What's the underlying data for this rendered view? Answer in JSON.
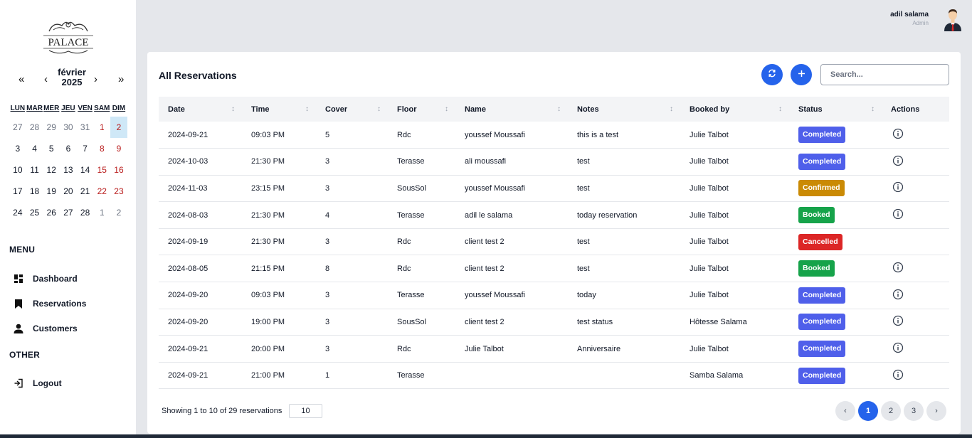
{
  "brand": {
    "logo_text": "PALACE"
  },
  "calendar": {
    "nav": {
      "prev_year": "«",
      "prev_month": "‹",
      "next_month": "›",
      "next_year": "»"
    },
    "month": "février",
    "year": "2025",
    "weekdays": [
      "LUN",
      "MAR",
      "MER",
      "JEU",
      "VEN",
      "SAM",
      "DIM"
    ],
    "weeks": [
      [
        "27",
        "28",
        "29",
        "30",
        "31",
        "1",
        "2"
      ],
      [
        "3",
        "4",
        "5",
        "6",
        "7",
        "8",
        "9"
      ],
      [
        "10",
        "11",
        "12",
        "13",
        "14",
        "15",
        "16"
      ],
      [
        "17",
        "18",
        "19",
        "20",
        "21",
        "22",
        "23"
      ],
      [
        "24",
        "25",
        "26",
        "27",
        "28",
        "1",
        "2"
      ]
    ]
  },
  "sidebar": {
    "menu_title": "MENU",
    "items": [
      {
        "label": "Dashboard",
        "icon": "dashboard-icon"
      },
      {
        "label": "Reservations",
        "icon": "bookmark-icon"
      },
      {
        "label": "Customers",
        "icon": "user-icon"
      }
    ],
    "other_title": "OTHER",
    "other_items": [
      {
        "label": "Logout",
        "icon": "logout-icon"
      }
    ]
  },
  "header": {
    "user_name": "adil salama",
    "user_role": "Admin"
  },
  "reservations": {
    "title": "All Reservations",
    "search_placeholder": "Search...",
    "columns": [
      "Date",
      "Time",
      "Cover",
      "Floor",
      "Name",
      "Notes",
      "Booked by",
      "Status",
      "Actions"
    ],
    "rows": [
      {
        "date": "2024-09-21",
        "time": "09:03 PM",
        "cover": "5",
        "floor": "Rdc",
        "name": "youssef Moussafi",
        "notes": "this is a test",
        "booked_by": "Julie Talbot",
        "status": "Completed"
      },
      {
        "date": "2024-10-03",
        "time": "21:30 PM",
        "cover": "3",
        "floor": "Terasse",
        "name": "ali moussafi",
        "notes": "test",
        "booked_by": "Julie Talbot",
        "status": "Completed"
      },
      {
        "date": "2024-11-03",
        "time": "23:15 PM",
        "cover": "3",
        "floor": "SousSol",
        "name": "youssef Moussafi",
        "notes": "test",
        "booked_by": "Julie Talbot",
        "status": "Confirmed"
      },
      {
        "date": "2024-08-03",
        "time": "21:30 PM",
        "cover": "4",
        "floor": "Terasse",
        "name": "adil le salama",
        "notes": "today reservation",
        "booked_by": "Julie Talbot",
        "status": "Booked"
      },
      {
        "date": "2024-09-19",
        "time": "21:30 PM",
        "cover": "3",
        "floor": "Rdc",
        "name": "client test 2",
        "notes": "test",
        "booked_by": "Julie Talbot",
        "status": "Cancelled"
      },
      {
        "date": "2024-08-05",
        "time": "21:15 PM",
        "cover": "8",
        "floor": "Rdc",
        "name": "client test 2",
        "notes": "test",
        "booked_by": "Julie Talbot",
        "status": "Booked"
      },
      {
        "date": "2024-09-20",
        "time": "09:03 PM",
        "cover": "3",
        "floor": "Terasse",
        "name": "youssef Moussafi",
        "notes": "today",
        "booked_by": "Julie Talbot",
        "status": "Completed"
      },
      {
        "date": "2024-09-20",
        "time": "19:00 PM",
        "cover": "3",
        "floor": "SousSol",
        "name": "client test 2",
        "notes": "test status",
        "booked_by": "Hôtesse Salama",
        "status": "Completed"
      },
      {
        "date": "2024-09-21",
        "time": "20:00 PM",
        "cover": "3",
        "floor": "Rdc",
        "name": "Julie Talbot",
        "notes": "Anniversaire",
        "booked_by": "Julie Talbot",
        "status": "Completed"
      },
      {
        "date": "2024-09-21",
        "time": "21:00 PM",
        "cover": "1",
        "floor": "Terasse",
        "name": "",
        "notes": "",
        "booked_by": "Samba Salama",
        "status": "Completed"
      }
    ],
    "status_colors": {
      "Completed": "#4f5fea",
      "Confirmed": "#ca8a04",
      "Booked": "#16a34a",
      "Cancelled": "#dc2626"
    },
    "footer_text": "Showing 1 to 10 of 29 reservations",
    "page_size": "10",
    "pagination": {
      "prev": "‹",
      "pages": [
        "1",
        "2",
        "3"
      ],
      "next": "›",
      "current": "1"
    }
  },
  "colors": {
    "accent": "#2563eb"
  }
}
